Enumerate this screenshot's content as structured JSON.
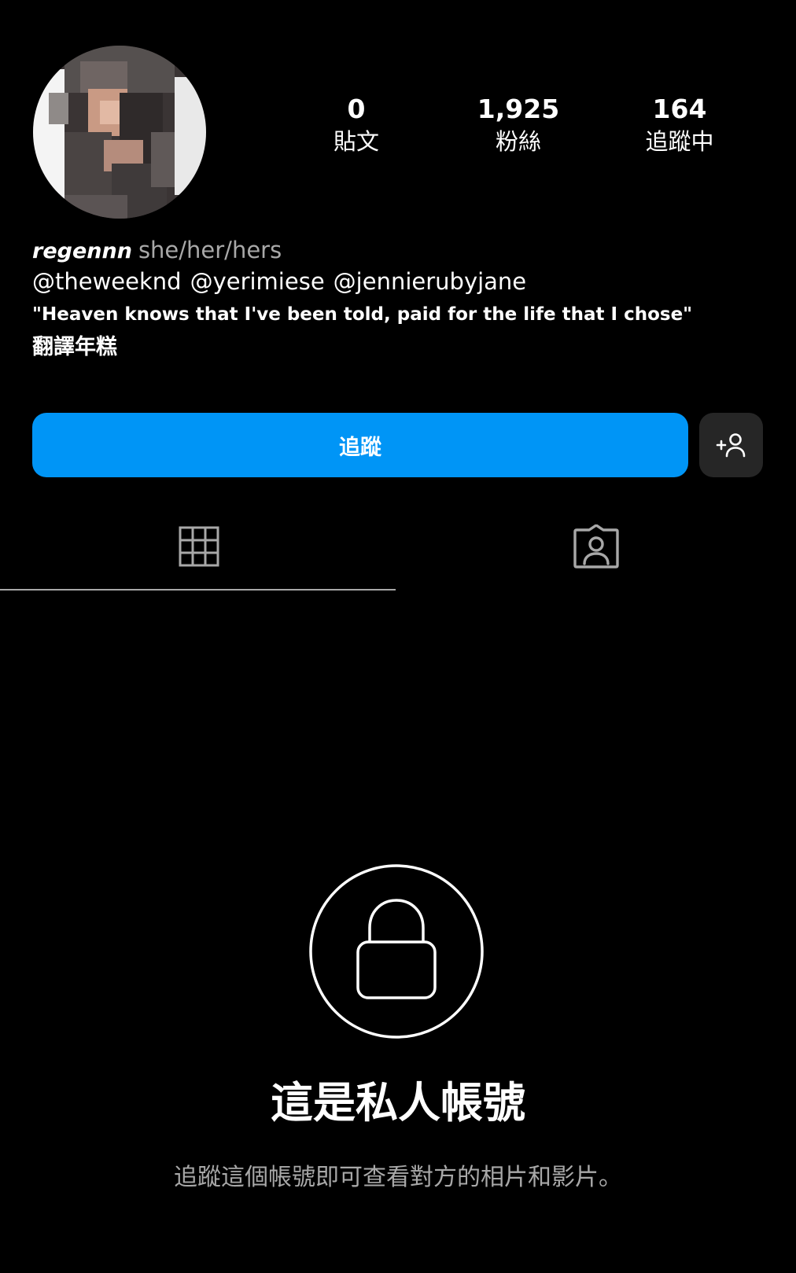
{
  "profile": {
    "username": "regennn",
    "pronouns": "she/her/hers",
    "bio_mentions": [
      "@theweeknd",
      "@yerimiese",
      "@jennierubyjane"
    ],
    "bio_quote": "\"Heaven knows that I've been told, paid for the life that I chose\"",
    "bio_note": "翻譯年糕"
  },
  "stats": {
    "posts": {
      "value": "0",
      "label": "貼文"
    },
    "followers": {
      "value": "1,925",
      "label": "粉絲"
    },
    "following": {
      "value": "164",
      "label": "追蹤中"
    }
  },
  "actions": {
    "follow_label": "追蹤",
    "suggest_icon": "add-person-icon"
  },
  "tabs": {
    "items": [
      {
        "icon": "grid-icon",
        "active": true
      },
      {
        "icon": "tagged-person-icon",
        "active": false
      }
    ]
  },
  "private_notice": {
    "icon": "lock-icon",
    "title": "這是私人帳號",
    "subtitle": "追蹤這個帳號即可查看對方的相片和影片。"
  },
  "colors": {
    "background": "#000000",
    "accent": "#0095f6",
    "secondary_button": "#262626",
    "muted_text": "#a8a8a8"
  }
}
